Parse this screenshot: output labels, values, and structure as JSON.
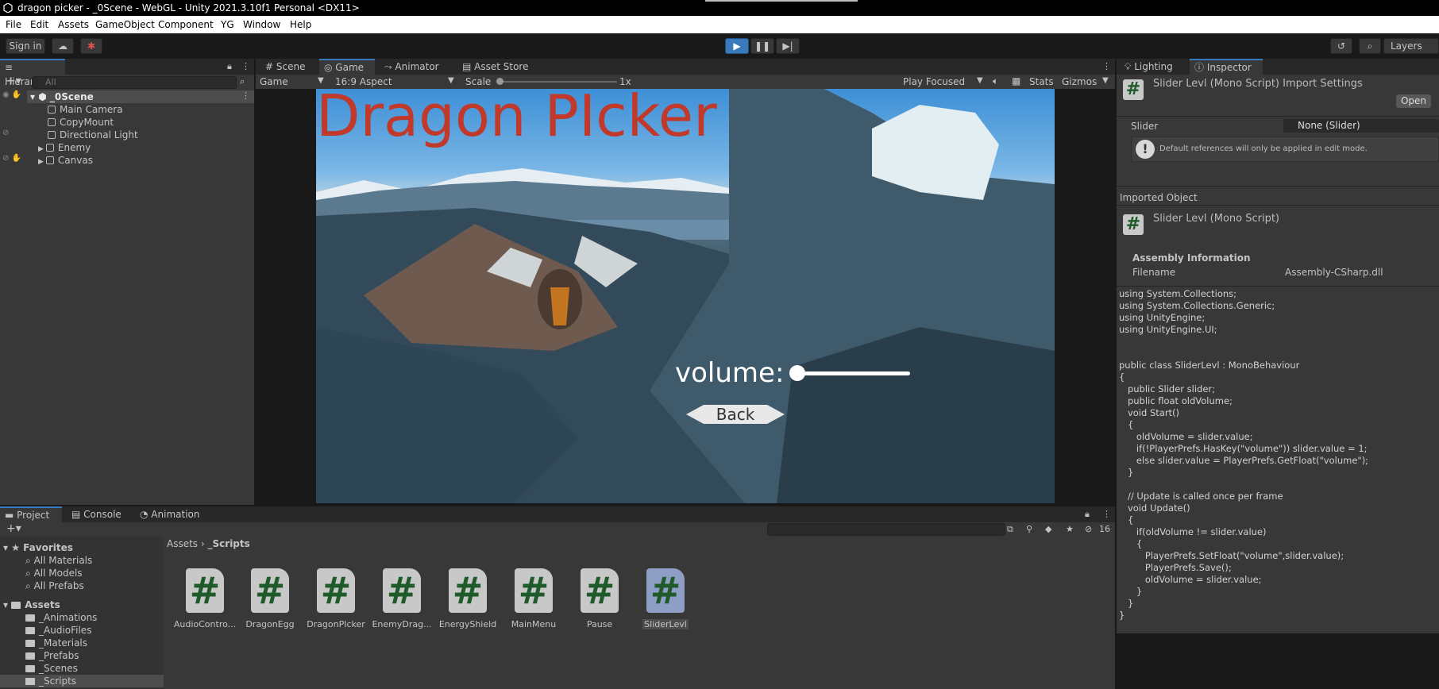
{
  "window": {
    "title": "dragon picker - _0Scene - WebGL - Unity 2021.3.10f1 Personal <DX11>"
  },
  "menu": [
    "File",
    "Edit",
    "Assets",
    "GameObject",
    "Component",
    "YG",
    "Window",
    "Help"
  ],
  "toolbar": {
    "sign_in": "Sign in",
    "layers": "Layers"
  },
  "hierarchy": {
    "tab": "Hierarchy",
    "search_placeholder": "All",
    "scene": "_0Scene",
    "items": [
      "Main Camera",
      "CopyMount",
      "Directional Light",
      "Enemy",
      "Canvas"
    ]
  },
  "scene_tabs": [
    "Scene",
    "Game",
    "Animator",
    "Asset Store"
  ],
  "game_toolbar": {
    "display": "Game",
    "aspect": "16:9 Aspect",
    "scale_label": "Scale",
    "scale_value": "1x",
    "play_mode": "Play Focused",
    "stats": "Stats",
    "gizmos": "Gizmos"
  },
  "game_view": {
    "title": "Dragon PIcker",
    "volume_label": "volume:",
    "volume_value": 0.0,
    "back_button": "Back"
  },
  "inspector": {
    "tabs": [
      "Lighting",
      "Inspector"
    ],
    "header": "Slider Levl (Mono Script) Import Settings",
    "open_button": "Open",
    "field_label": "Slider",
    "field_value": "None (Slider)",
    "help_text": "Default references will only be applied in edit mode.",
    "imported_object_label": "Imported Object",
    "imported_object_name": "Slider Levl (Mono Script)",
    "assembly_header": "Assembly Information",
    "filename_label": "Filename",
    "filename_value": "Assembly-CSharp.dll",
    "code": "using System.Collections;\nusing System.Collections.Generic;\nusing UnityEngine;\nusing UnityEngine.UI;\n\n\npublic class SliderLevl : MonoBehaviour\n{\n   public Slider slider;\n   public float oldVolume;\n   void Start()\n   {\n      oldVolume = slider.value;\n      if(!PlayerPrefs.HasKey(\"volume\")) slider.value = 1;\n      else slider.value = PlayerPrefs.GetFloat(\"volume\");\n   }\n\n   // Update is called once per frame\n   void Update()\n   {\n      if(oldVolume != slider.value)\n      {\n         PlayerPrefs.SetFloat(\"volume\",slider.value);\n         PlayerPrefs.Save();\n         oldVolume = slider.value;\n      }\n   }\n}"
  },
  "project": {
    "tabs": [
      "Project",
      "Console",
      "Animation"
    ],
    "hidden_count": "16",
    "favorites_label": "Favorites",
    "favorites": [
      "All Materials",
      "All Models",
      "All Prefabs"
    ],
    "assets_label": "Assets",
    "folders": [
      "_Animations",
      "_AudioFiles",
      "_Materials",
      "_Prefabs",
      "_Scenes",
      "_Scripts"
    ],
    "breadcrumb": [
      "Assets",
      "_Scripts"
    ],
    "files": [
      "AudioContro...",
      "DragonEgg",
      "DragonPIcker",
      "EnemyDrag...",
      "EnergyShield",
      "MainMenu",
      "Pause",
      "SliderLevl"
    ]
  },
  "colors": {
    "accent": "#3a79bb",
    "title_red": "#c0392b",
    "panel": "#383838",
    "dark": "#282828"
  }
}
